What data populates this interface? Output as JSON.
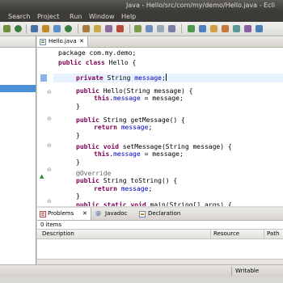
{
  "window": {
    "title": "Java - Hello/src/com/my/demo/Hello.java - Ecli"
  },
  "menu": {
    "items": [
      "Search",
      "Project",
      "Run",
      "Window",
      "Help"
    ]
  },
  "editor": {
    "tab_label": "Hello.java",
    "tab_close": "✕",
    "lines": [
      {
        "parts": [
          {
            "t": "package com.my.demo;",
            "c": ""
          }
        ]
      },
      {
        "parts": [
          {
            "t": "public class ",
            "c": "kw"
          },
          {
            "t": "Hello {",
            "c": ""
          }
        ]
      },
      {
        "parts": [
          {
            "t": "private ",
            "c": "kw"
          },
          {
            "t": "String ",
            "c": ""
          },
          {
            "t": "message",
            "c": "fld"
          },
          {
            "t": ";",
            "c": ""
          }
        ]
      },
      {
        "parts": [
          {
            "t": "public ",
            "c": "kw"
          },
          {
            "t": "Hello(String message) {",
            "c": ""
          }
        ]
      },
      {
        "parts": [
          {
            "t": "this",
            "c": "kw"
          },
          {
            "t": ".",
            "c": ""
          },
          {
            "t": "message",
            "c": "fld"
          },
          {
            "t": " = message;",
            "c": ""
          }
        ]
      },
      {
        "parts": [
          {
            "t": "}",
            "c": ""
          }
        ]
      },
      {
        "parts": [
          {
            "t": "public ",
            "c": "kw"
          },
          {
            "t": "String getMessage() {",
            "c": ""
          }
        ]
      },
      {
        "parts": [
          {
            "t": "return ",
            "c": "kw"
          },
          {
            "t": "message",
            "c": "fld"
          },
          {
            "t": ";",
            "c": ""
          }
        ]
      },
      {
        "parts": [
          {
            "t": "}",
            "c": ""
          }
        ]
      },
      {
        "parts": [
          {
            "t": "public void ",
            "c": "kw"
          },
          {
            "t": "setMessage(String message) {",
            "c": ""
          }
        ]
      },
      {
        "parts": [
          {
            "t": "this",
            "c": "kw"
          },
          {
            "t": ".",
            "c": ""
          },
          {
            "t": "message",
            "c": "fld"
          },
          {
            "t": " = message;",
            "c": ""
          }
        ]
      },
      {
        "parts": [
          {
            "t": "}",
            "c": ""
          }
        ]
      },
      {
        "parts": [
          {
            "t": "@Override",
            "c": "ann"
          }
        ]
      },
      {
        "parts": [
          {
            "t": "public ",
            "c": "kw"
          },
          {
            "t": "String toString() {",
            "c": ""
          }
        ]
      },
      {
        "parts": [
          {
            "t": "return ",
            "c": "kw"
          },
          {
            "t": "message",
            "c": "fld"
          },
          {
            "t": ";",
            "c": ""
          }
        ]
      },
      {
        "parts": [
          {
            "t": "}",
            "c": ""
          }
        ]
      },
      {
        "parts": [
          {
            "t": "public static void ",
            "c": "kw"
          },
          {
            "t": "main(String[] args) {",
            "c": ""
          }
        ]
      }
    ]
  },
  "bottom_panel": {
    "tabs": [
      {
        "label": "Problems",
        "close": "✕",
        "icon": "problems-icon"
      },
      {
        "label": "Javadoc",
        "icon": "javadoc-icon"
      },
      {
        "label": "Declaration",
        "icon": "declaration-icon"
      }
    ],
    "count": "0 items",
    "columns": [
      "Description",
      "Resource",
      "Path"
    ]
  },
  "status": {
    "mode": "Writable"
  }
}
